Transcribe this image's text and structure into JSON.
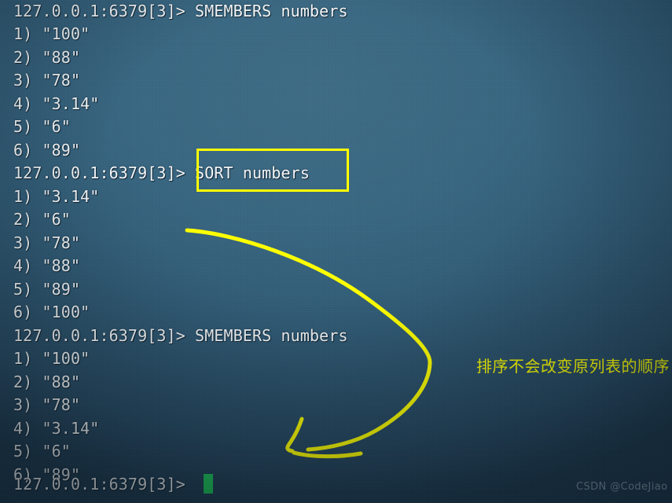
{
  "terminal": {
    "prompt": "127.0.0.1:6379[3]>",
    "font_color": "#f4f7f8",
    "background_color": "#386580",
    "lines": [
      {
        "text": "127.0.0.1:6379[3]> SMEMBERS numbers",
        "kind": "prompt-command"
      },
      {
        "text": "1) \"100\"",
        "kind": "output"
      },
      {
        "text": "2) \"88\"",
        "kind": "output"
      },
      {
        "text": "3) \"78\"",
        "kind": "output"
      },
      {
        "text": "4) \"3.14\"",
        "kind": "output"
      },
      {
        "text": "5) \"6\"",
        "kind": "output"
      },
      {
        "text": "6) \"89\"",
        "kind": "output"
      },
      {
        "text": "127.0.0.1:6379[3]> SORT numbers",
        "kind": "prompt-command"
      },
      {
        "text": "1) \"3.14\"",
        "kind": "output"
      },
      {
        "text": "2) \"6\"",
        "kind": "output"
      },
      {
        "text": "3) \"78\"",
        "kind": "output"
      },
      {
        "text": "4) \"88\"",
        "kind": "output"
      },
      {
        "text": "5) \"89\"",
        "kind": "output"
      },
      {
        "text": "6) \"100\"",
        "kind": "output"
      },
      {
        "text": "127.0.0.1:6379[3]> SMEMBERS numbers",
        "kind": "prompt-command"
      },
      {
        "text": "1) \"100\"",
        "kind": "output"
      },
      {
        "text": "2) \"88\"",
        "kind": "output"
      },
      {
        "text": "3) \"78\"",
        "kind": "output"
      },
      {
        "text": "4) \"3.14\"",
        "kind": "output"
      },
      {
        "text": "5) \"6\"",
        "kind": "output"
      },
      {
        "text": "6) \"89\"",
        "kind": "output"
      },
      {
        "text": "127.0.0.1:6379[3]>",
        "kind": "prompt-only"
      }
    ],
    "cursor": {
      "color": "#1fcc5c",
      "shape": "block"
    }
  },
  "annotations": {
    "highlight_box": {
      "target_text": "SORT numbers",
      "color": "#ffff00"
    },
    "arrow": {
      "color": "#ffff00",
      "direction": "left",
      "style": "hand-drawn-curve"
    },
    "note": {
      "text": "排序不会改变原列表的顺序",
      "color": "#ffff00"
    }
  },
  "watermark": {
    "text": "CSDN @CodeJiao",
    "color": "#8fa3b1"
  }
}
